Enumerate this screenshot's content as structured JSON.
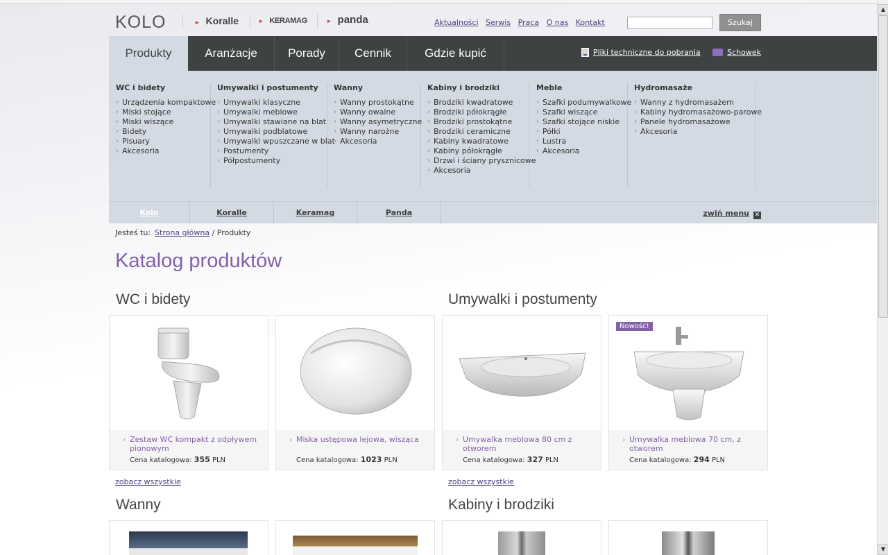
{
  "header": {
    "logo": "KOLO",
    "brands": [
      "Koralle",
      "KERAMAG",
      "panda"
    ],
    "top_links": [
      "Aktualności",
      "Serwis",
      "Praca",
      "O nas",
      "Kontakt"
    ],
    "search": {
      "value": "",
      "button": "Szukaj"
    }
  },
  "nav": {
    "tabs": [
      "Produkty",
      "Aranżacje",
      "Porady",
      "Cennik",
      "Gdzie kupić"
    ],
    "active_tab": "Produkty",
    "links": {
      "downloads": "Pliki techniczne do pobrania",
      "favorites": "Schowek"
    }
  },
  "megamenu": {
    "columns": [
      {
        "title": "WC i bidety",
        "items": [
          "Urządzenia kompaktowe",
          "Miski stojące",
          "Miski wiszące",
          "Bidety",
          "Pisuary",
          "Akcesoria"
        ]
      },
      {
        "title": "Umywalki i postumenty",
        "items": [
          "Umywalki klasyczne",
          "Umywalki meblowe",
          "Umywalki stawiane na blat",
          "Umywalki podblatowe",
          "Umywalki wpuszczane w blat",
          "Postumenty",
          "Półpostumenty"
        ]
      },
      {
        "title": "Wanny",
        "items": [
          "Wanny prostokątne",
          "Wanny owalne",
          "Wanny asymetryczne",
          "Wanny narożne",
          "Akcesoria"
        ]
      },
      {
        "title": "Kabiny i brodziki",
        "items": [
          "Brodziki kwadratowe",
          "Brodziki półokrągłe",
          "Brodziki prostokątne",
          "Brodziki ceramiczne",
          "Kabiny kwadratowe",
          "Kabiny półokrągłe",
          "Drzwi i ściany prysznicowe",
          "Akcesoria"
        ]
      },
      {
        "title": "Meble",
        "items": [
          "Szafki podumywalkowe",
          "Szafki wiszące",
          "Szafki stojące niskie",
          "Półki",
          "Lustra",
          "Akcesoria"
        ]
      },
      {
        "title": "Hydromasaże",
        "items": [
          "Wanny z hydromasażem",
          "Kabiny hydromasażowo-parowe",
          "Panele hydromasażowe",
          "Akcesoria"
        ]
      }
    ],
    "brand_tabs": [
      "Kolo",
      "Koralle",
      "Keramag",
      "Panda"
    ],
    "collapse_label": "zwiń menu"
  },
  "breadcrumb": {
    "label": "Jesteś tu:",
    "home": "Strona główna",
    "current": "/ Produkty"
  },
  "page_title": "Katalog produktów",
  "sections": [
    {
      "title": "WC i bidety",
      "see_all": "zobacz wszystkie"
    },
    {
      "title": "Umywalki i postumenty",
      "see_all": "zobacz wszystkie"
    },
    {
      "title": "Wanny"
    },
    {
      "title": "Kabiny i brodziki"
    }
  ],
  "price_label": "Cena katalogowa:",
  "currency": "PLN",
  "products": [
    {
      "name": "Zestaw WC kompakt z odpływem pionowym",
      "price": "355"
    },
    {
      "name": "Miska ustępowa lejowa, wisząca",
      "price": "1023"
    },
    {
      "name": "Umywalka meblowa 80 cm z otworem",
      "price": "327"
    },
    {
      "name": "Umywalka meblowa 70 cm, z otworem",
      "price": "294",
      "badge": "Nowość!"
    }
  ],
  "colors": {
    "accent": "#8262a6",
    "nav_dark": "#3f4243",
    "menu_bg": "#d4dae3",
    "link": "#4c3f7e"
  }
}
